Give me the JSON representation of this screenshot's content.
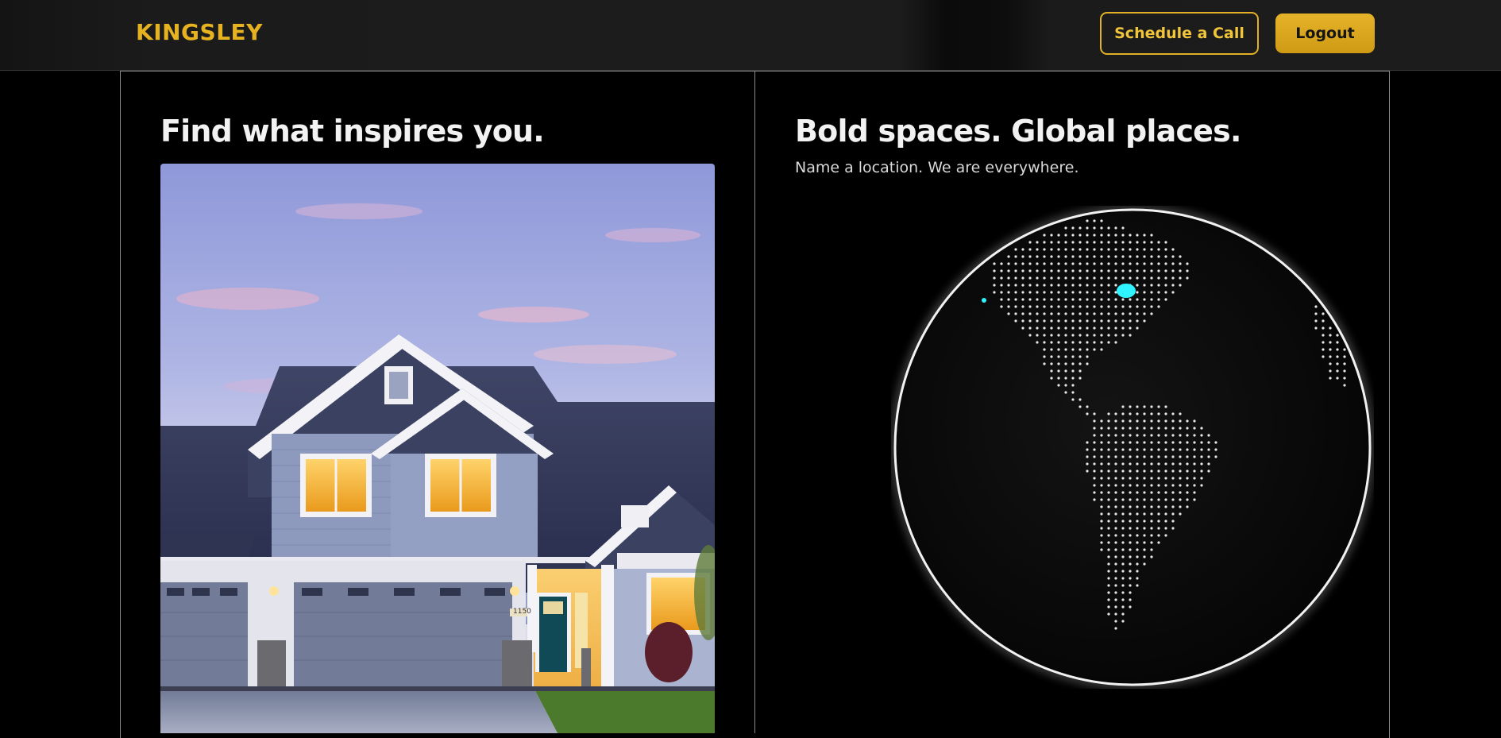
{
  "header": {
    "brand": "KINGSLEY",
    "schedule_label": "Schedule a Call",
    "logout_label": "Logout"
  },
  "left_panel": {
    "title": "Find what inspires you.",
    "house_number": "1150"
  },
  "right_panel": {
    "title": "Bold spaces. Global places.",
    "subtitle": "Name a location. We are everywhere."
  },
  "colors": {
    "accent": "#e6b21f",
    "background": "#000000",
    "globe_highlight": "#2ff3ff"
  }
}
